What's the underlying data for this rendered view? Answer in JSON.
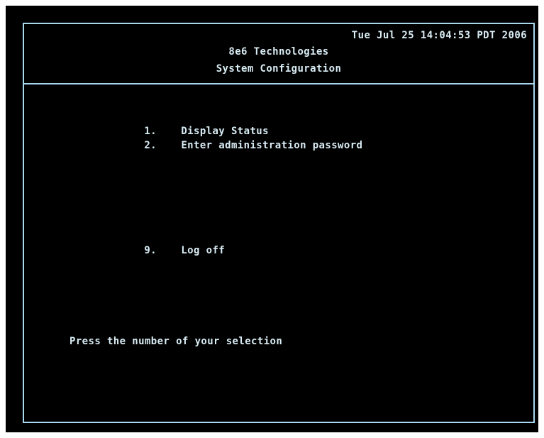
{
  "header": {
    "datetime": "Tue Jul 25 14:04:53 PDT 2006",
    "company": "8e6 Technologies",
    "subtitle": "System Configuration"
  },
  "menu": {
    "items": [
      {
        "number": "1.",
        "label": "Display Status"
      },
      {
        "number": "2.",
        "label": "Enter administration password"
      },
      {
        "number": "9.",
        "label": "Log off"
      }
    ]
  },
  "prompt": "Press the number of your selection",
  "colors": {
    "background": "#000000",
    "text": "#d8ecf4",
    "border": "#a9d7ee",
    "page": "#ffffff"
  }
}
